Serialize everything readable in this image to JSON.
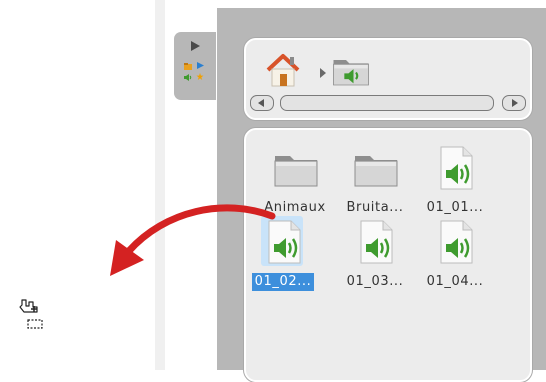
{
  "side_tab": {
    "icons": [
      "expand-arrow-icon",
      "folder-icon",
      "play-icon",
      "speaker-icon",
      "star-icon"
    ]
  },
  "address_bar": {
    "breadcrumb": [
      "home-icon",
      "chevron-right-icon",
      "audio-folder-icon"
    ],
    "scrollbar": {
      "left_button": "scroll-left-icon",
      "right_button": "scroll-right-icon"
    }
  },
  "files": [
    {
      "label": "Animaux",
      "icon": "folder-icon",
      "selected": false
    },
    {
      "label": "Bruita...",
      "icon": "folder-icon",
      "selected": false
    },
    {
      "label": "01_01...",
      "icon": "audio-file-icon",
      "selected": false
    },
    {
      "label": "01_02...",
      "icon": "audio-file-icon",
      "selected": true
    },
    {
      "label": "01_03...",
      "icon": "audio-file-icon",
      "selected": false
    },
    {
      "label": "01_04...",
      "icon": "audio-file-icon",
      "selected": false
    }
  ],
  "overlay": {
    "arrow": "drag-arrow-icon",
    "cursor": "drag-copy-cursor-icon"
  },
  "colors": {
    "panel": "#b7b7b7",
    "box": "#ececec",
    "selection": "#3d8fdc",
    "arrow": "#d42222",
    "speaker": "#3f9b2f"
  }
}
